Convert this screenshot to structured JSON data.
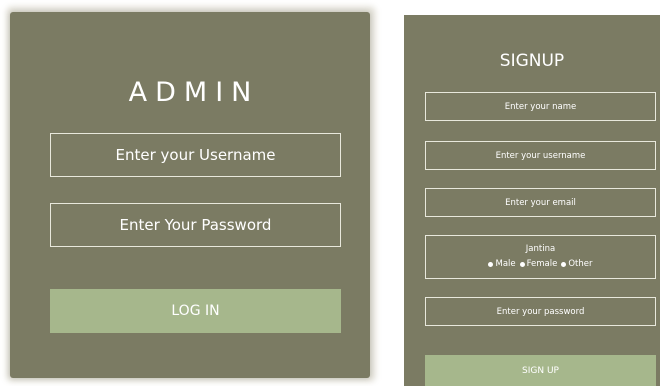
{
  "admin": {
    "title": "ADMIN",
    "username_placeholder": "Enter your Username",
    "password_placeholder": "Enter Your Password",
    "login_label": "LOG IN"
  },
  "signup": {
    "title": "SIGNUP",
    "name_placeholder": "Enter your name",
    "username_placeholder": "Enter your username",
    "email_placeholder": "Enter your email",
    "gender_label": "Jantina",
    "gender_options": [
      "Male",
      "Female",
      "Other"
    ],
    "password_placeholder": "Enter your password",
    "signup_label": "SIGN UP"
  },
  "colors": {
    "panel": "#7b7b63",
    "button": "#a6b78c",
    "border": "#e8e8dc"
  }
}
